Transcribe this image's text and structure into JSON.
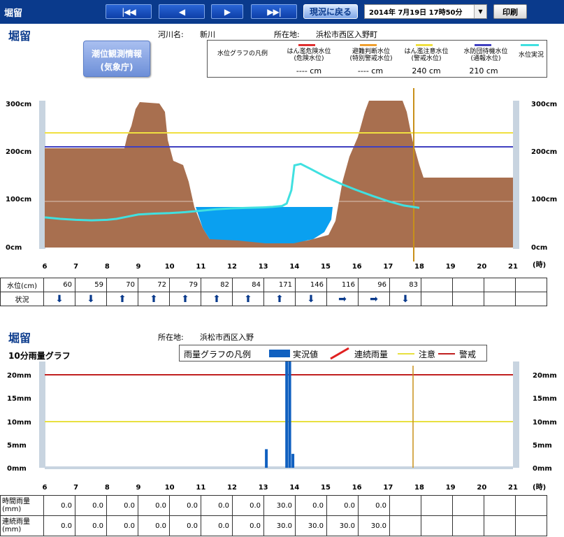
{
  "header": {
    "title": "堀留",
    "nav": [
      "|◀◀",
      "◀",
      "▶",
      "▶▶|"
    ],
    "back_label": "現況に戻る",
    "datetime": "2014年 7月19日 17時50分",
    "print_label": "印刷"
  },
  "water": {
    "title": "堀留",
    "river_label": "河川名:",
    "river": "新川",
    "location_label": "所在地:",
    "location": "浜松市西区入野町",
    "tide_button": [
      "潮位観測情報",
      "(気象庁)"
    ],
    "legend": {
      "title": "水位グラフの凡例",
      "items": [
        {
          "label1": "はん濫危険水位",
          "label2": "(危険水位)",
          "value": "---- cm",
          "color": "#e03030"
        },
        {
          "label1": "避難判断水位",
          "label2": "(特別警戒水位)",
          "value": "---- cm",
          "color": "#f0a030"
        },
        {
          "label1": "はん濫注意水位",
          "label2": "(警戒水位)",
          "value": "240 cm",
          "color": "#f0e040"
        },
        {
          "label1": "水防団待機水位",
          "label2": "(通報水位)",
          "value": "210 cm",
          "color": "#4040c0"
        },
        {
          "label1": "水位実況",
          "label2": "",
          "value": "",
          "color": "#40e0e0"
        }
      ]
    },
    "y_ticks": [
      "300cm",
      "200cm",
      "100cm",
      "0cm"
    ],
    "x_ticks": [
      "6",
      "7",
      "8",
      "9",
      "10",
      "11",
      "12",
      "13",
      "14",
      "15",
      "16",
      "17",
      "18",
      "19",
      "20",
      "21"
    ],
    "x_unit": "(時)",
    "table": {
      "row1_label": "水位(cm)",
      "row2_label": "状況",
      "levels": [
        "60",
        "59",
        "70",
        "72",
        "79",
        "82",
        "84",
        "171",
        "146",
        "116",
        "96",
        "83",
        "",
        "",
        "",
        ""
      ],
      "status": [
        "down",
        "down",
        "up",
        "up",
        "up",
        "up",
        "up",
        "up",
        "down",
        "right",
        "right",
        "down",
        "",
        "",
        "",
        ""
      ]
    }
  },
  "chart_data": [
    {
      "type": "line",
      "series": [
        {
          "x": [
            6.0,
            6.5,
            7.0,
            7.5,
            8.0,
            8.3,
            8.6,
            9.0,
            9.5,
            10.0,
            10.5,
            11.0,
            11.5,
            12.0,
            12.5,
            13.0,
            13.3,
            13.6,
            13.75,
            13.9,
            14.0,
            14.2,
            14.5,
            15.0,
            15.5,
            16.0,
            16.5,
            17.0,
            17.5,
            17.8,
            18.0
          ],
          "y": [
            63,
            60,
            58,
            57,
            58,
            60,
            64,
            69,
            71,
            72,
            74,
            77,
            80,
            82,
            83,
            84,
            85,
            87,
            92,
            120,
            172,
            175,
            165,
            148,
            133,
            120,
            108,
            97,
            88,
            85,
            83
          ]
        }
      ],
      "x_range": [
        6,
        21
      ],
      "ylim": [
        0,
        300
      ]
    },
    {
      "type": "bar",
      "x": [
        13.1,
        13.75,
        13.85,
        13.95
      ],
      "values": [
        4,
        30,
        30,
        3
      ],
      "x_range": [
        6,
        21
      ],
      "ylim": [
        0,
        20
      ]
    }
  ],
  "rain": {
    "title": "堀留",
    "location_label": "所在地:",
    "location": "浜松市西区入野",
    "subtitle": "10分雨量グラフ",
    "legend": {
      "title": "雨量グラフの凡例",
      "actual": "実況値",
      "cumulative": "連続雨量",
      "caution": "注意",
      "warning": "警戒"
    },
    "y_ticks": [
      "20mm",
      "15mm",
      "10mm",
      "5mm",
      "0mm"
    ],
    "x_ticks": [
      "6",
      "7",
      "8",
      "9",
      "10",
      "11",
      "12",
      "13",
      "14",
      "15",
      "16",
      "17",
      "18",
      "19",
      "20",
      "21"
    ],
    "x_unit": "(時)",
    "table": {
      "row1_label1": "時間雨量",
      "row1_label2": "(mm)",
      "row2_label1": "連続雨量",
      "row2_label2": "(mm)",
      "hourly": [
        "0.0",
        "0.0",
        "0.0",
        "0.0",
        "0.0",
        "0.0",
        "0.0",
        "30.0",
        "0.0",
        "0.0",
        "0.0",
        "",
        "",
        "",
        "",
        ""
      ],
      "cumulative": [
        "0.0",
        "0.0",
        "0.0",
        "0.0",
        "0.0",
        "0.0",
        "0.0",
        "30.0",
        "30.0",
        "30.0",
        "30.0",
        "",
        "",
        "",
        "",
        ""
      ]
    }
  }
}
